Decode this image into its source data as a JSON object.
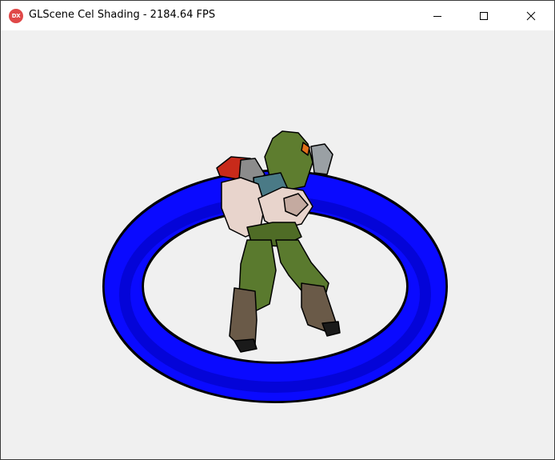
{
  "window": {
    "title": "GLScene Cel Shading - 2184.64 FPS",
    "app_icon_text": "DX",
    "app_icon_color": "#e04848"
  },
  "caption_buttons": {
    "minimize_icon": "minimize-icon",
    "maximize_icon": "maximize-icon",
    "close_icon": "close-icon"
  },
  "scene": {
    "background_color": "#f0f0f0",
    "ring_color": "#0a0aff",
    "ring_shadow_color": "#0000b8",
    "outline_color": "#000000",
    "figure_body_color": "#5a7a2e",
    "figure_arm_color": "#e8d4cc",
    "figure_boot_color": "#6a5a48",
    "figure_shoulder_color": "#c82a1a"
  }
}
